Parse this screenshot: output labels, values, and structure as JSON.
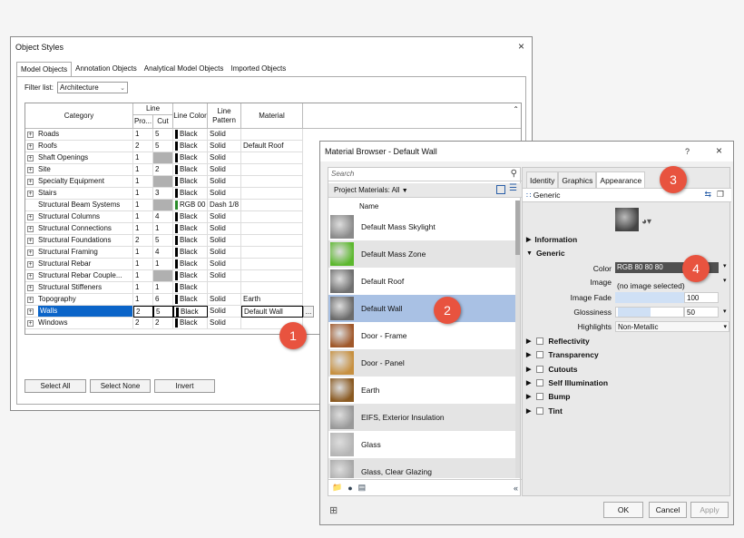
{
  "object_styles": {
    "title": "Object Styles",
    "tabs": [
      "Model Objects",
      "Annotation Objects",
      "Analytical Model Objects",
      "Imported Objects"
    ],
    "filter_label": "Filter list:",
    "filter_value": "Architecture",
    "headers": {
      "category": "Category",
      "line": "Line",
      "line_pro": "Pro...",
      "line_cut": "Cut",
      "line_color": "Line Color",
      "line_pattern": "Line Pattern",
      "material": "Material"
    },
    "rows": [
      {
        "name": "Roads",
        "pro": "1",
        "cut": "5",
        "color": "Black",
        "pattern": "Solid",
        "material": "",
        "expand": true
      },
      {
        "name": "Roofs",
        "pro": "2",
        "cut": "5",
        "color": "Black",
        "pattern": "Solid",
        "material": "Default Roof",
        "expand": true
      },
      {
        "name": "Shaft Openings",
        "pro": "1",
        "cut": "",
        "color": "Black",
        "pattern": "Solid",
        "material": "",
        "expand": true
      },
      {
        "name": "Site",
        "pro": "1",
        "cut": "2",
        "color": "Black",
        "pattern": "Solid",
        "material": "",
        "expand": true
      },
      {
        "name": "Specialty Equipment",
        "pro": "1",
        "cut": "",
        "color": "Black",
        "pattern": "Solid",
        "material": "",
        "expand": true
      },
      {
        "name": "Stairs",
        "pro": "1",
        "cut": "3",
        "color": "Black",
        "pattern": "Solid",
        "material": "",
        "expand": true
      },
      {
        "name": "Structural Beam Systems",
        "pro": "1",
        "cut": "",
        "color": "RGB 00",
        "pattern": "Dash 1/8",
        "material": "",
        "expand": false
      },
      {
        "name": "Structural Columns",
        "pro": "1",
        "cut": "4",
        "color": "Black",
        "pattern": "Solid",
        "material": "",
        "expand": true
      },
      {
        "name": "Structural Connections",
        "pro": "1",
        "cut": "1",
        "color": "Black",
        "pattern": "Solid",
        "material": "",
        "expand": true
      },
      {
        "name": "Structural Foundations",
        "pro": "2",
        "cut": "5",
        "color": "Black",
        "pattern": "Solid",
        "material": "",
        "expand": true
      },
      {
        "name": "Structural Framing",
        "pro": "1",
        "cut": "4",
        "color": "Black",
        "pattern": "Solid",
        "material": "",
        "expand": true
      },
      {
        "name": "Structural Rebar",
        "pro": "1",
        "cut": "1",
        "color": "Black",
        "pattern": "Solid",
        "material": "",
        "expand": true
      },
      {
        "name": "Structural Rebar Couple...",
        "pro": "1",
        "cut": "",
        "color": "Black",
        "pattern": "Solid",
        "material": "",
        "expand": true
      },
      {
        "name": "Structural Stiffeners",
        "pro": "1",
        "cut": "1",
        "color": "Black",
        "pattern": "",
        "material": "",
        "expand": true
      },
      {
        "name": "Topography",
        "pro": "1",
        "cut": "6",
        "color": "Black",
        "pattern": "Solid",
        "material": "Earth",
        "expand": true
      },
      {
        "name": "Walls",
        "pro": "2",
        "cut": "5",
        "color": "Black",
        "pattern": "Solid",
        "material": "Default Wall",
        "expand": true,
        "selected": true
      },
      {
        "name": "Windows",
        "pro": "2",
        "cut": "2",
        "color": "Black",
        "pattern": "Solid",
        "material": "",
        "expand": true
      }
    ],
    "buttons": {
      "select_all": "Select All",
      "select_none": "Select None",
      "invert": "Invert"
    },
    "browse_button": "...",
    "close": "×"
  },
  "material_browser": {
    "title": "Material Browser - Default Wall",
    "help": "?",
    "close": "×",
    "search_placeholder": "Search",
    "project_materials": "Project Materials: All",
    "list_header": "Name",
    "materials": [
      {
        "name": "Default Mass Skylight",
        "color": "#8a8a8a"
      },
      {
        "name": "Default Mass Zone",
        "color": "#5cb82e"
      },
      {
        "name": "Default Roof",
        "color": "#707070"
      },
      {
        "name": "Default Wall",
        "color": "#6b6b6b",
        "selected": true
      },
      {
        "name": "Door - Frame",
        "color": "#a0582a"
      },
      {
        "name": "Door - Panel",
        "color": "#c79040"
      },
      {
        "name": "Earth",
        "color": "#8a5a22"
      },
      {
        "name": "EIFS, Exterior Insulation",
        "color": "#999999"
      },
      {
        "name": "Glass",
        "color": "#b5b5b5"
      },
      {
        "name": "Glass, Clear Glazing",
        "color": "#a8a8a8"
      }
    ],
    "tabs": [
      "Identity",
      "Graphics",
      "Appearance"
    ],
    "generic_label": "Generic",
    "sections": {
      "information": "Information",
      "generic": "Generic"
    },
    "props": {
      "color_label": "Color",
      "color_value": "RGB 80 80 80",
      "image_label": "Image",
      "image_value": "(no image selected)",
      "image_fade_label": "Image Fade",
      "image_fade_value": "100",
      "glossiness_label": "Glossiness",
      "glossiness_value": "50",
      "highlights_label": "Highlights",
      "highlights_value": "Non-Metallic"
    },
    "collapsed_sections": [
      "Reflectivity",
      "Transparency",
      "Cutouts",
      "Self Illumination",
      "Bump",
      "Tint"
    ],
    "buttons": {
      "ok": "OK",
      "cancel": "Cancel",
      "apply": "Apply"
    }
  },
  "callouts": [
    "1",
    "2",
    "3",
    "4"
  ],
  "colors": {
    "callout": "#e8533f",
    "selection": "#0a64c8",
    "list_selection": "#a9c1e4"
  }
}
